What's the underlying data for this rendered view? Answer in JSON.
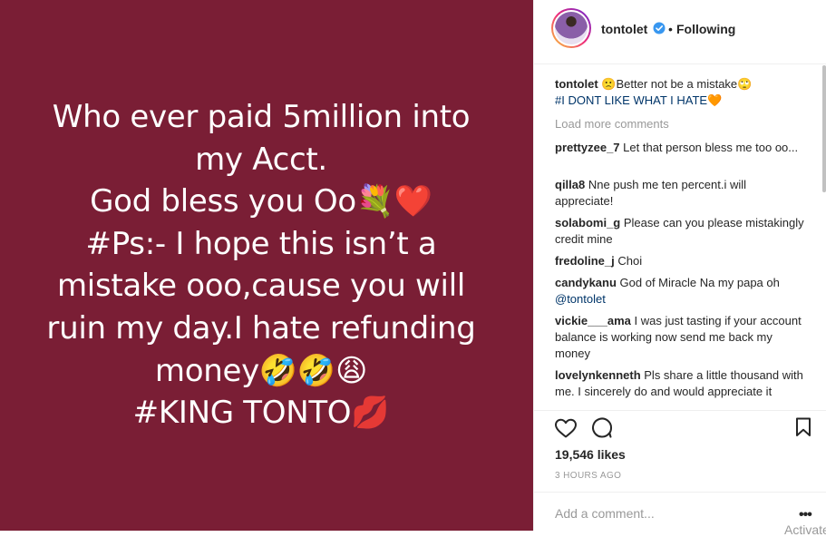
{
  "post": {
    "lines": [
      "Who ever paid 5million into",
      "my Acct.",
      "God bless you Oo💐❤️",
      "#Ps:- I hope this isn’t a",
      "mistake ooo,cause you will",
      "ruin my day.I hate refunding",
      "money🤣🤣😩",
      "#KING TONTO💋"
    ],
    "background_color": "#7a1e35"
  },
  "header": {
    "username": "tontolet",
    "separator": "•",
    "follow_status": "Following",
    "verified_icon": "verified-badge-icon"
  },
  "caption": {
    "username": "tontolet",
    "emoji1": "🙁",
    "text": "Better not be a mistake",
    "emoji2": "🙄",
    "hashtag": "#I DONT LIKE WHAT I HATE",
    "emoji3": "🧡"
  },
  "load_more": "Load more comments",
  "comments": [
    {
      "user": "prettyzee_7",
      "text": "Let that person bless me too oo..."
    },
    {
      "user": "qilla8",
      "text": "Nne push me ten percent.i will appreciate!"
    },
    {
      "user": "solabomi_g",
      "text": "Please can you please mistakingly credit mine"
    },
    {
      "user": "fredoline_j",
      "text": "Choi"
    },
    {
      "user": "candykanu",
      "text": "God of Miracle Na my papa oh",
      "mention": "@tontolet"
    },
    {
      "user": "vickie___ama",
      "text": "I was just tasting if your account balance is working now send me back my money"
    },
    {
      "user": "lovelynkenneth",
      "text": "Pls share a little thousand with me. I sincerely do and would appreciate it"
    }
  ],
  "likes": "19,546 likes",
  "time": "3 HOURS AGO",
  "add_comment_placeholder": "Add a comment...",
  "more_label": "•••",
  "activity_label": "Activate"
}
